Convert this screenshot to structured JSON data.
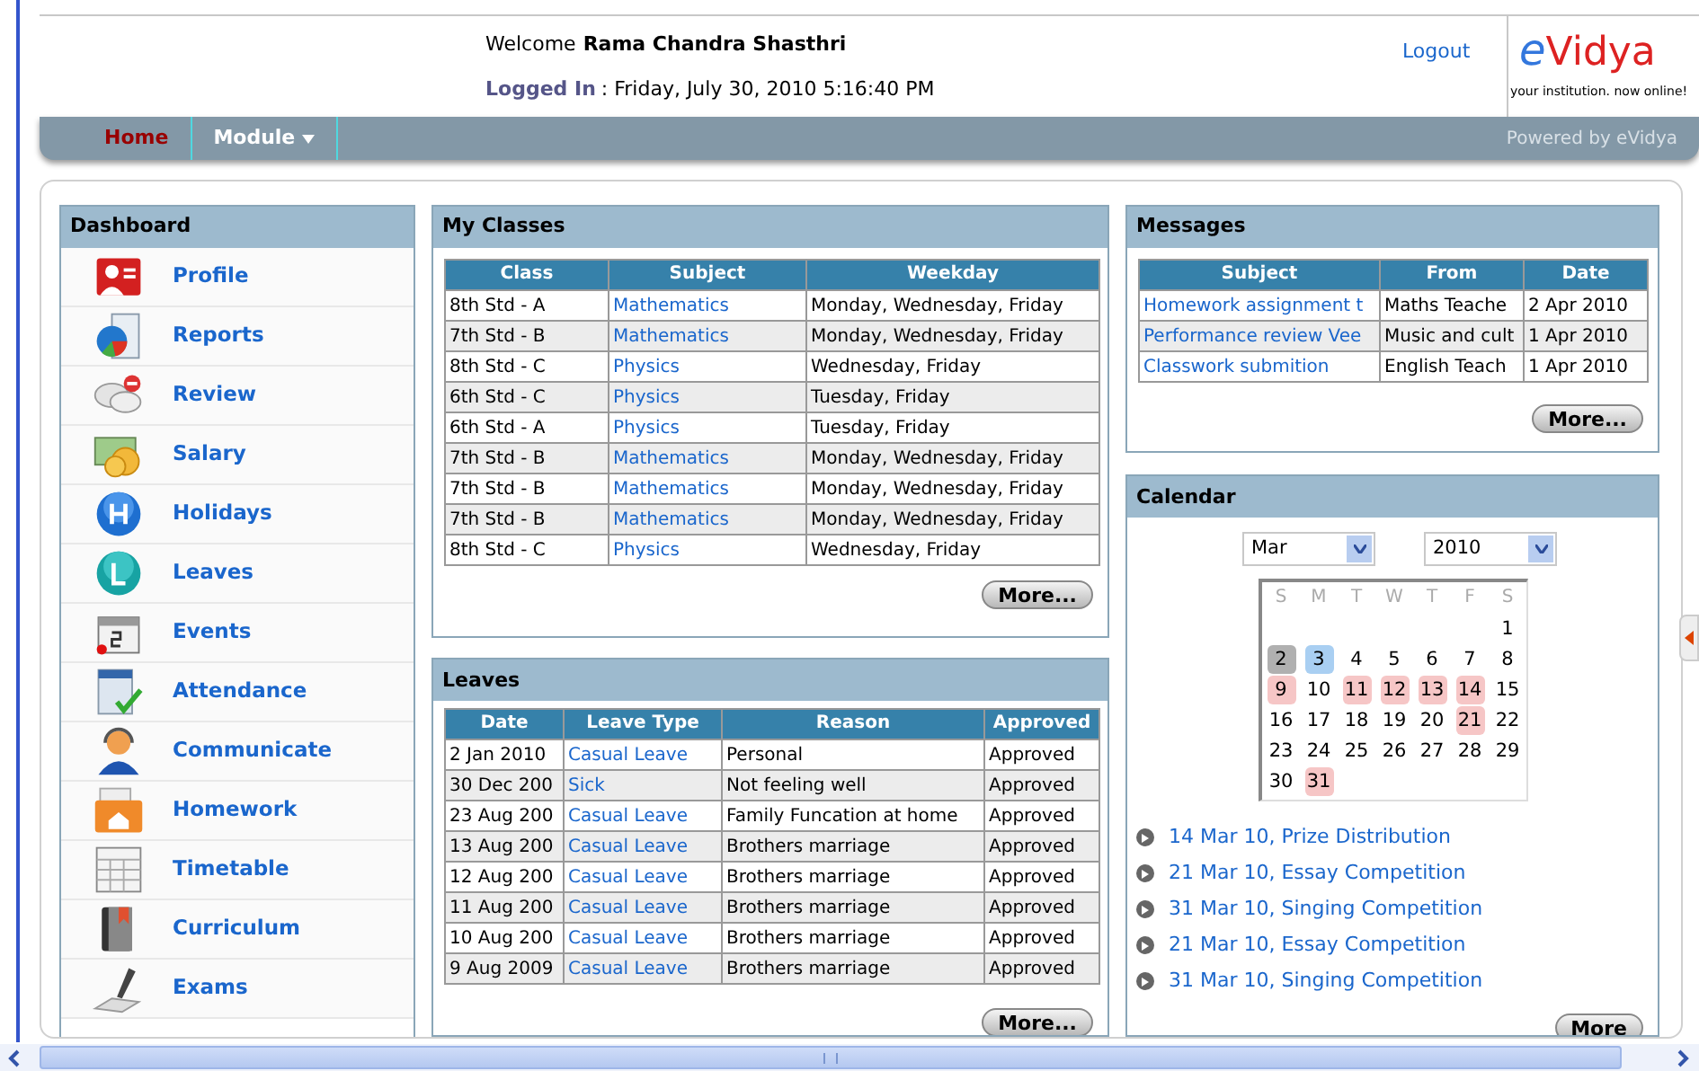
{
  "header": {
    "welcome_label": "Welcome",
    "user_name": "Rama Chandra Shasthri",
    "logged_in_label": "Logged In",
    "logged_in_value": ": Friday, July 30, 2010 5:16:40 PM",
    "logout": "Logout",
    "logo_text_e": "e",
    "logo_text_rest": "Vidya",
    "logo_tagline": "your institution. now online!"
  },
  "nav": {
    "items": [
      {
        "label": "Home",
        "selected": true,
        "dropdown": false
      },
      {
        "label": "Module",
        "selected": false,
        "dropdown": true
      }
    ],
    "powered_by": "Powered by eVidya"
  },
  "dashboard": {
    "title": "Dashboard",
    "items": [
      {
        "label": "Profile"
      },
      {
        "label": "Reports"
      },
      {
        "label": "Review"
      },
      {
        "label": "Salary"
      },
      {
        "label": "Holidays"
      },
      {
        "label": "Leaves"
      },
      {
        "label": "Events"
      },
      {
        "label": "Attendance"
      },
      {
        "label": "Communicate"
      },
      {
        "label": "Homework"
      },
      {
        "label": "Timetable"
      },
      {
        "label": "Curriculum"
      },
      {
        "label": "Exams"
      }
    ]
  },
  "my_classes": {
    "title": "My Classes",
    "columns": [
      "Class",
      "Subject",
      "Weekday"
    ],
    "rows": [
      [
        "8th Std - A",
        "Mathematics",
        "Monday, Wednesday, Friday"
      ],
      [
        "7th Std - B",
        "Mathematics",
        "Monday, Wednesday, Friday"
      ],
      [
        "8th Std - C",
        "Physics",
        "Wednesday, Friday"
      ],
      [
        "6th Std - C",
        "Physics",
        "Tuesday, Friday"
      ],
      [
        "6th Std - A",
        "Physics",
        "Tuesday, Friday"
      ],
      [
        "7th Std - B",
        "Mathematics",
        "Monday, Wednesday, Friday"
      ],
      [
        "7th Std - B",
        "Mathematics",
        "Monday, Wednesday, Friday"
      ],
      [
        "7th Std - B",
        "Mathematics",
        "Monday, Wednesday, Friday"
      ],
      [
        "8th Std - C",
        "Physics",
        "Wednesday, Friday"
      ]
    ],
    "more": "More..."
  },
  "leaves": {
    "title": "Leaves",
    "columns": [
      "Date",
      "Leave Type",
      "Reason",
      "Approved"
    ],
    "rows": [
      [
        "2 Jan 2010",
        "Casual Leave",
        "Personal",
        "Approved"
      ],
      [
        "30 Dec 200",
        "Sick",
        "Not feeling well",
        "Approved"
      ],
      [
        "23 Aug 200",
        "Casual Leave",
        "Family Funcation at home",
        "Approved"
      ],
      [
        "13 Aug 200",
        "Casual Leave",
        "Brothers marriage",
        "Approved"
      ],
      [
        "12 Aug 200",
        "Casual Leave",
        "Brothers marriage",
        "Approved"
      ],
      [
        "11 Aug 200",
        "Casual Leave",
        "Brothers marriage",
        "Approved"
      ],
      [
        "10 Aug 200",
        "Casual Leave",
        "Brothers marriage",
        "Approved"
      ],
      [
        "9 Aug 2009",
        "Casual Leave",
        "Brothers marriage",
        "Approved"
      ]
    ],
    "more": "More..."
  },
  "messages": {
    "title": "Messages",
    "columns": [
      "Subject",
      "From",
      "Date"
    ],
    "rows": [
      [
        "Homework assignment t",
        "Maths Teache",
        "2 Apr 2010"
      ],
      [
        "Performance review Vee",
        "Music and cult",
        "1 Apr 2010"
      ],
      [
        "Classwork submition",
        "English Teach",
        "1 Apr 2010"
      ]
    ],
    "more": "More..."
  },
  "calendar": {
    "title": "Calendar",
    "month": "Mar",
    "year": "2010",
    "weekdays": [
      "S",
      "M",
      "T",
      "W",
      "T",
      "F",
      "S"
    ],
    "weeks": [
      [
        {
          "day": "1",
          "kind": "normal"
        }
      ],
      [
        {
          "day": "2",
          "kind": "today"
        },
        {
          "day": "3",
          "kind": "selected"
        },
        {
          "day": "4",
          "kind": "normal"
        },
        {
          "day": "5",
          "kind": "normal"
        },
        {
          "day": "6",
          "kind": "normal"
        },
        {
          "day": "7",
          "kind": "normal"
        },
        {
          "day": "8",
          "kind": "normal"
        }
      ],
      [
        {
          "day": "9",
          "kind": "event"
        },
        {
          "day": "10",
          "kind": "normal"
        },
        {
          "day": "11",
          "kind": "event"
        },
        {
          "day": "12",
          "kind": "event"
        },
        {
          "day": "13",
          "kind": "event"
        },
        {
          "day": "14",
          "kind": "event"
        },
        {
          "day": "15",
          "kind": "normal"
        }
      ],
      [
        {
          "day": "16",
          "kind": "normal"
        },
        {
          "day": "17",
          "kind": "normal"
        },
        {
          "day": "18",
          "kind": "normal"
        },
        {
          "day": "19",
          "kind": "normal"
        },
        {
          "day": "20",
          "kind": "normal"
        },
        {
          "day": "21",
          "kind": "event"
        },
        {
          "day": "22",
          "kind": "normal"
        }
      ],
      [
        {
          "day": "23",
          "kind": "normal"
        },
        {
          "day": "24",
          "kind": "normal"
        },
        {
          "day": "25",
          "kind": "normal"
        },
        {
          "day": "26",
          "kind": "normal"
        },
        {
          "day": "27",
          "kind": "normal"
        },
        {
          "day": "28",
          "kind": "normal"
        },
        {
          "day": "29",
          "kind": "normal"
        }
      ],
      [
        {
          "day": "30",
          "kind": "normal"
        },
        {
          "day": "31",
          "kind": "event"
        }
      ]
    ],
    "events": [
      "14 Mar 10, Prize Distribution",
      "21 Mar 10, Essay Competition",
      "31 Mar 10, Singing Competition",
      "21 Mar 10, Essay Competition",
      "31 Mar 10, Singing Competition"
    ],
    "more": "More"
  }
}
